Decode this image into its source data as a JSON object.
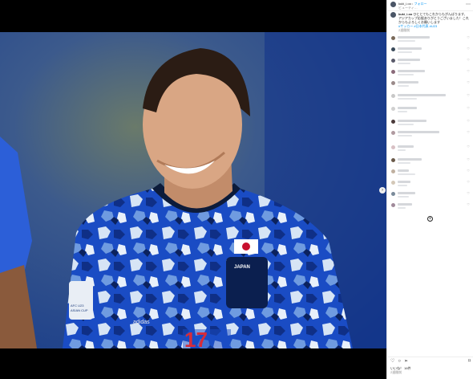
{
  "post": {
    "username": "kuki_i.oo",
    "follow_label": "フォロー",
    "location": "ビューティ…",
    "caption_line1": "ひととてもこれからもがんばります、",
    "caption_line2": "アジアカップ応援ありがとうございました！これからもよろしくお願いします",
    "caption_tags": "#サッカー #日本代表 #U23",
    "caption_time": "2週間前",
    "likes_text": "いいね！ 16件",
    "date_text": "2週間前"
  },
  "photo": {
    "jersey_text": "JAPAN",
    "jersey_number": "17",
    "badge_line1": "AFC U23",
    "badge_line2": "ASIAN CUP",
    "sponsor": "adidas"
  },
  "icons": {
    "more": "more-options-icon",
    "next": "chevron-right-icon",
    "heart": "heart-icon",
    "comment": "comment-icon",
    "share": "share-icon",
    "bookmark": "bookmark-icon",
    "load_more": "plus-circle-icon"
  }
}
